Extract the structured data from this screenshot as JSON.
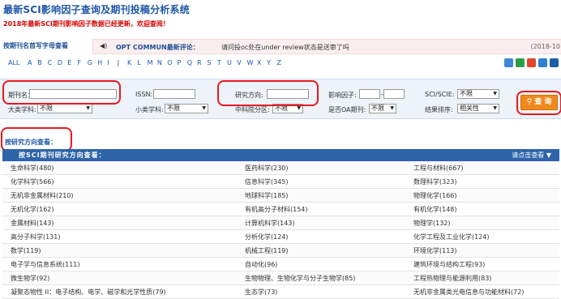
{
  "header": {
    "title": "最新SCI影响因子查询及期刊投稿分析系统",
    "notice": "2018年最新SCI期刊影响因子数据已经更新，欢迎查阅！"
  },
  "letter_nav": {
    "label": "按期刊名首写字母查看",
    "letters": [
      "ALL",
      "A",
      "B",
      "C",
      "D",
      "E",
      "F",
      "G",
      "H",
      "I",
      "J",
      "K",
      "L",
      "M",
      "N",
      "O",
      "P",
      "Q",
      "R",
      "S",
      "T",
      "U",
      "V",
      "W",
      "X",
      "Y",
      "Z"
    ]
  },
  "news": {
    "source": "OPT COMMUN最新评论：",
    "text": "请问投oc处在under review状态是送审了吗",
    "date": "(2018-10"
  },
  "filter": {
    "journal_label": "期刊名：",
    "issn_label": "ISSN:",
    "direction_label": "研究方向:",
    "if_label": "影响因子:",
    "if_dash": "—",
    "sci_label": "SCI/SCIE:",
    "sci_value": "不限",
    "major_label": "大类学科:",
    "major_value": "不限",
    "minor_label": "小类学科:",
    "minor_value": "不限",
    "cas_label": "中科院分区:",
    "cas_value": "不限",
    "oa_label": "是否OA期刊:",
    "oa_value": "不限",
    "sort_label": "结果排序:",
    "sort_value": "相关性",
    "search_button": "查 询"
  },
  "directions": {
    "label": "按研究方向查看：",
    "header_title": "按SCI期刊研究方向查看：",
    "header_right": "请点击查看 ▼",
    "rows": [
      [
        "生命科学(480)",
        "医药科学(230)",
        "工程与材料(667)"
      ],
      [
        "化学科学(566)",
        "信息科学(345)",
        "数理科学(323)"
      ],
      [
        "无机非金属材料(210)",
        "地球科学(185)",
        "物理化学(166)"
      ],
      [
        "无机化学(162)",
        "有机高分子材料(154)",
        "有机化学(148)"
      ],
      [
        "金属材料(143)",
        "计算机科学(143)",
        "物理学(132)"
      ],
      [
        "高分子科学(131)",
        "分析化学(124)",
        "化学工程及工业化学(124)"
      ],
      [
        "数学(119)",
        "机械工程(119)",
        "环境化学(113)"
      ],
      [
        "电子学与信息系统(111)",
        "自动化(96)",
        "建筑环境与结构工程(93)"
      ],
      [
        "微生物学(92)",
        "生物物理、生物化学与分子生物学(85)",
        "工程热物理与能源利用(83)"
      ],
      [
        "凝聚态物性 II：电子结构、电学、磁学和光学性质(79)",
        "生态学(73)",
        "无机非金属类光电信息与功能材料(72)"
      ]
    ]
  },
  "colors": {
    "brand": "#1f57a8",
    "accent": "#f08a1d",
    "alert": "#d60000",
    "highlight": "#e8191f"
  },
  "icons": [
    "speaker-icon",
    "search-icon",
    "toolbar-icons"
  ]
}
